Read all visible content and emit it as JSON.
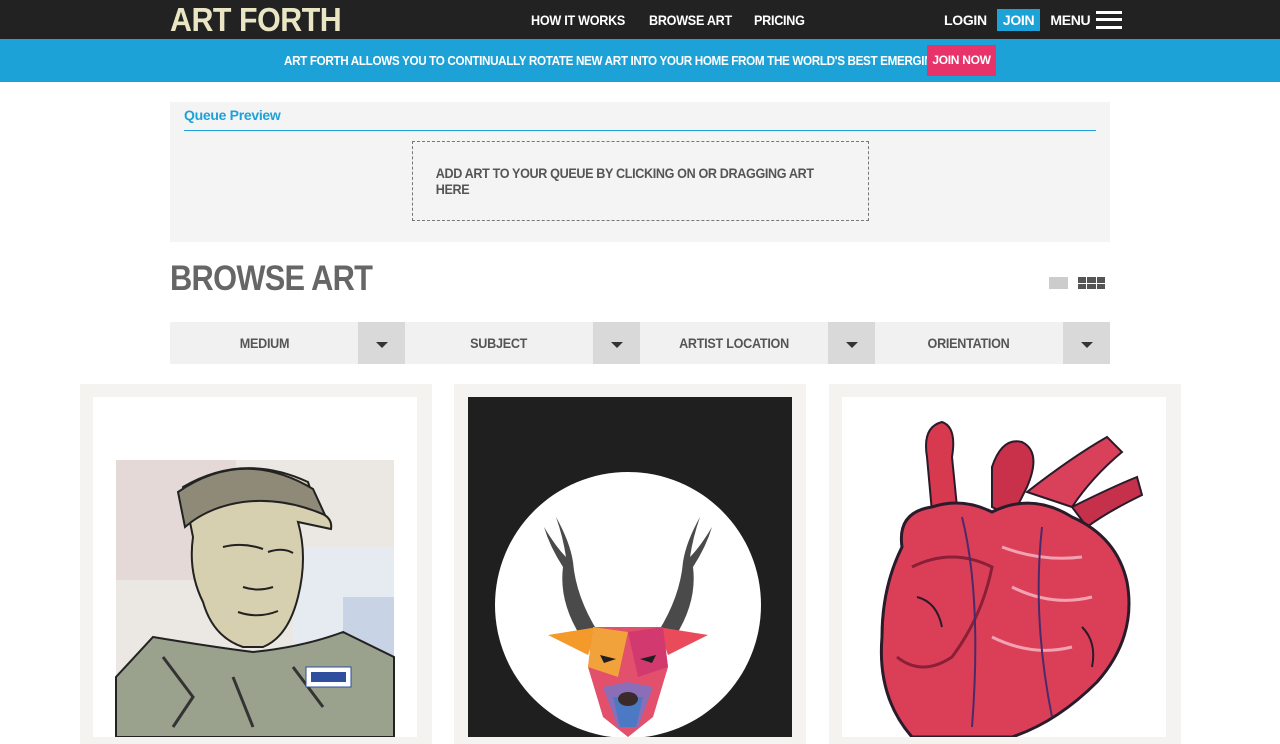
{
  "header": {
    "logo": "ART FORTH",
    "nav": [
      {
        "label": "HOW IT WORKS"
      },
      {
        "label": "BROWSE ART"
      },
      {
        "label": "PRICING"
      }
    ],
    "login_label": "LOGIN",
    "join_label": "JOIN",
    "menu_label": "MENU"
  },
  "promo": {
    "text": "ART FORTH ALLOWS YOU TO CONTINUALLY ROTATE NEW ART INTO YOUR HOME FROM THE WORLD'S BEST EMERGING ARTISTS",
    "button_label": "JOIN NOW"
  },
  "queue": {
    "title": "Queue Preview",
    "drop_text": "ADD ART TO YOUR QUEUE BY CLICKING ON OR DRAGGING ART HERE"
  },
  "browse": {
    "title": "BROWSE ART",
    "filters": [
      {
        "label": "MEDIUM"
      },
      {
        "label": "SUBJECT"
      },
      {
        "label": "ARTIST LOCATION"
      },
      {
        "label": "ORIENTATION"
      }
    ]
  },
  "artworks": [
    {
      "subject": "portrait-collage-man-in-cap"
    },
    {
      "subject": "geometric-deer-head-in-circle"
    },
    {
      "subject": "anatomical-heart-illustration"
    }
  ],
  "colors": {
    "topbar": "#222222",
    "accent_blue": "#1da2d8",
    "accent_pink": "#e8336a",
    "logo": "#eae6c4"
  }
}
